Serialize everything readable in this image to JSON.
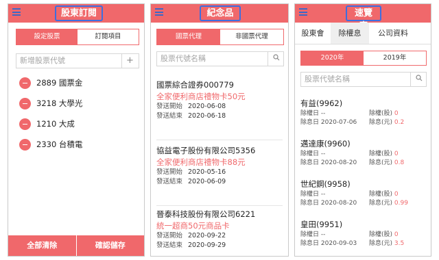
{
  "panel1": {
    "title": "股東訂閱",
    "tabs": [
      "設定股票",
      "訂閱項目"
    ],
    "input_placeholder": "新增股票代號",
    "add_icon": "+",
    "stocks": [
      "2889 國票金",
      "3218 大學光",
      "1210 大成",
      "2330 台積電"
    ],
    "bottom": {
      "clear": "全部清除",
      "confirm": "確認儲存"
    }
  },
  "panel2": {
    "title": "紀念品",
    "tabs": [
      "國票代理",
      "非國票代理"
    ],
    "search_placeholder": "股票代號名稱",
    "items": [
      {
        "company": "國票綜合證券000779",
        "prize": "全家便利商店禮物卡50元",
        "start_label": "發送開始",
        "start": "2020-06-08",
        "end_label": "發送結束",
        "end": "2020-06-18"
      },
      {
        "company": "協益電子股份有限公司5356",
        "prize": "全家便利商店禮物卡88元",
        "start_label": "發送開始",
        "start": "2020-05-16",
        "end_label": "發送結束",
        "end": "2020-06-09"
      },
      {
        "company": "晉泰科技股份有限公司6221",
        "prize": "統一超商50元商品卡",
        "start_label": "發送開始",
        "start": "2020-09-22",
        "end_label": "發送結束",
        "end": "2020-09-29"
      }
    ]
  },
  "panel3": {
    "title": "速覽表",
    "tabs": [
      "股東會",
      "除權息",
      "公司資料"
    ],
    "years": [
      "2020年",
      "2019年"
    ],
    "search_placeholder": "股票代號名稱",
    "items": [
      {
        "name": "有益(9962)",
        "xr_label": "除權日",
        "xr": "--",
        "xd_label": "除息日",
        "xd": "2020-07-06",
        "stock_label": "除權(股)",
        "stock": "0",
        "cash_label": "除息(元)",
        "cash": "0.2"
      },
      {
        "name": "邁達康(9960)",
        "xr_label": "除權日",
        "xr": "--",
        "xd_label": "除息日",
        "xd": "2020-08-20",
        "stock_label": "除權(股)",
        "stock": "0",
        "cash_label": "除息(元)",
        "cash": "0.8"
      },
      {
        "name": "世紀鋼(9958)",
        "xr_label": "除權日",
        "xr": "--",
        "xd_label": "除息日",
        "xd": "2020-08-20",
        "stock_label": "除權(股)",
        "stock": "0",
        "cash_label": "除息(元)",
        "cash": "0.99"
      },
      {
        "name": "皇田(9951)",
        "xr_label": "除權日",
        "xr": "--",
        "xd_label": "除息日",
        "xd": "2020-09-03",
        "stock_label": "除權(股)",
        "stock": "0",
        "cash_label": "除息(元)",
        "cash": "3.5"
      }
    ]
  },
  "icons": {
    "menu": "menu-icon",
    "search": "search-icon",
    "add": "add-icon",
    "remove": "minus-circle-icon"
  },
  "colors": {
    "accent": "#f0686b",
    "highlight_border": "#3d6ee0",
    "menu_icon": "#3d68c6"
  }
}
